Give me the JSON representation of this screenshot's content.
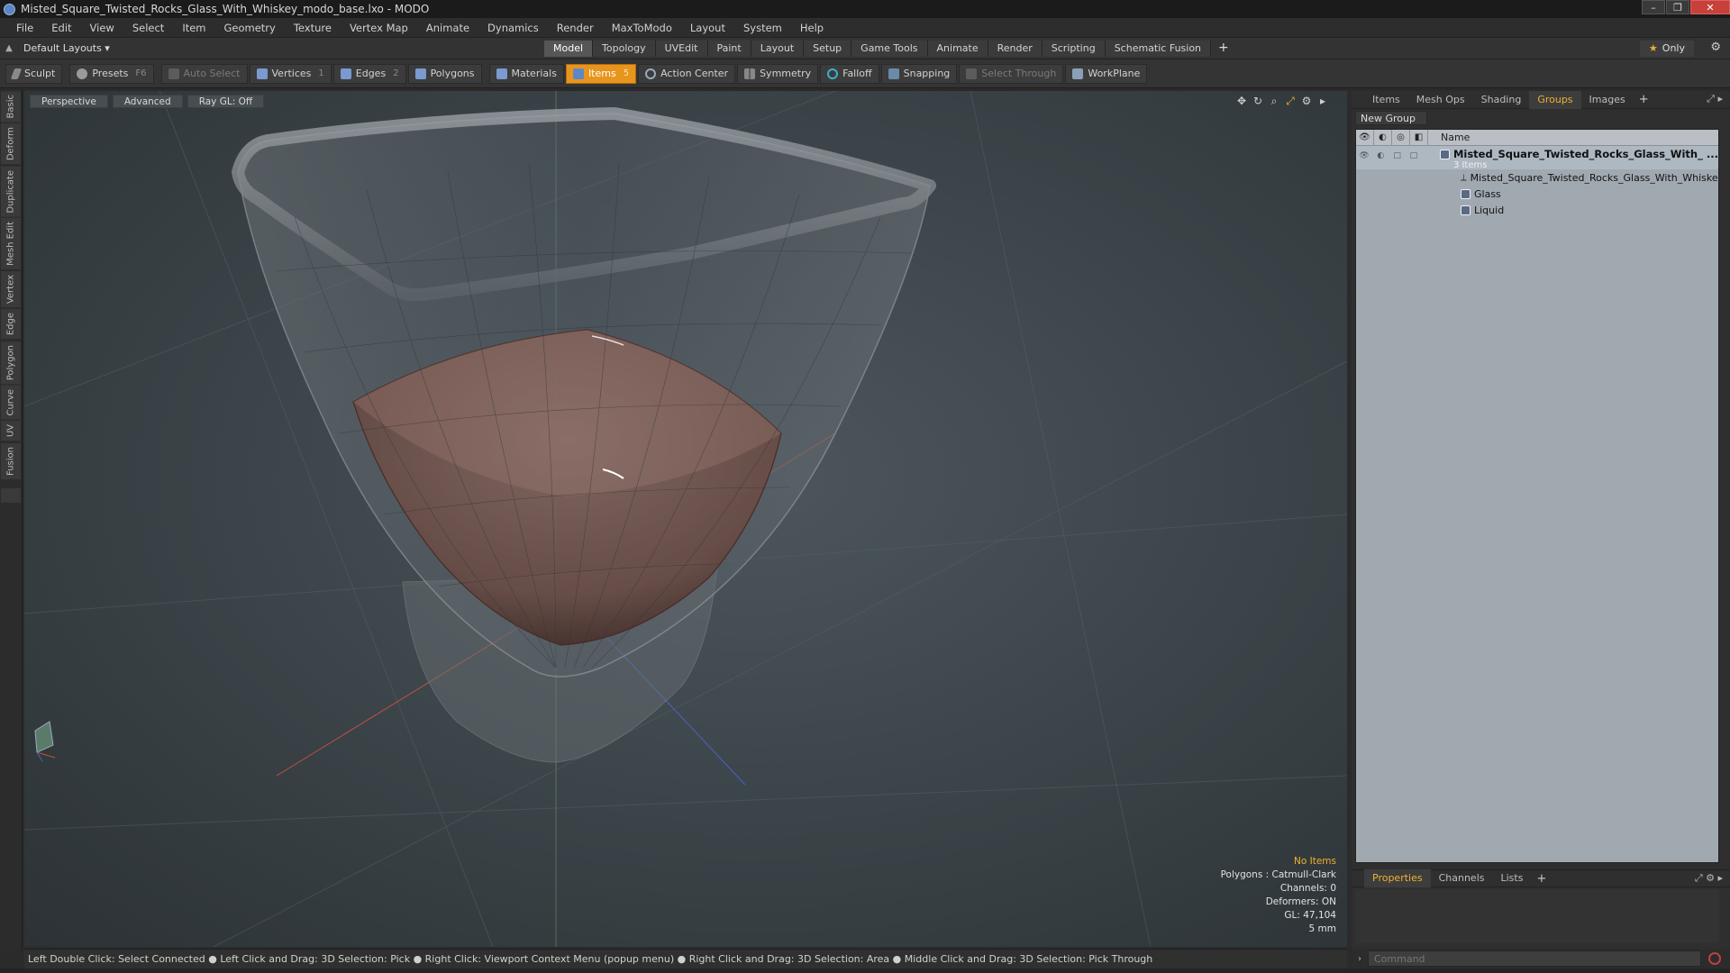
{
  "window": {
    "title": "Misted_Square_Twisted_Rocks_Glass_With_Whiskey_modo_base.lxo - MODO",
    "controls": [
      "–",
      "❐",
      "✕"
    ]
  },
  "menu": [
    "File",
    "Edit",
    "View",
    "Select",
    "Item",
    "Geometry",
    "Texture",
    "Vertex Map",
    "Animate",
    "Dynamics",
    "Render",
    "MaxToModo",
    "Layout",
    "System",
    "Help"
  ],
  "layout_bar": {
    "layout_select": "Default Layouts ▾",
    "tabs": [
      "Model",
      "Topology",
      "UVEdit",
      "Paint",
      "Layout",
      "Setup",
      "Game Tools",
      "Animate",
      "Render",
      "Scripting",
      "Schematic Fusion"
    ],
    "active_tab": "Model",
    "only_label": "Only"
  },
  "toolbar": {
    "sculpt": "Sculpt",
    "presets": "Presets",
    "presets_key": "F6",
    "auto_select": "Auto Select",
    "vertices": "Vertices",
    "vertices_count": "1",
    "edges": "Edges",
    "edges_count": "2",
    "polygons": "Polygons",
    "materials": "Materials",
    "items": "Items",
    "items_count": "5",
    "action_center": "Action Center",
    "symmetry": "Symmetry",
    "falloff": "Falloff",
    "snapping": "Snapping",
    "select_through": "Select Through",
    "workplane": "WorkPlane"
  },
  "left_tabs": [
    "Basic",
    "Deform",
    "Duplicate",
    "Mesh Edit",
    "Vertex",
    "Edge",
    "Polygon",
    "Curve",
    "UV",
    "Fusion"
  ],
  "viewport": {
    "view_mode": "Perspective",
    "shading": "Advanced",
    "raygl": "Ray GL: Off",
    "info": {
      "no_items": "No Items",
      "polygons": "Polygons : Catmull-Clark",
      "channels": "Channels: 0",
      "deformers": "Deformers: ON",
      "gl": "GL: 47,104",
      "scale": "5 mm"
    }
  },
  "status_bar": "Left Double Click: Select Connected ● Left Click and Drag: 3D Selection: Pick ● Right Click: Viewport Context Menu (popup menu) ● Right Click and Drag: 3D Selection: Area ● Middle Click and Drag: 3D Selection: Pick Through",
  "right_panel": {
    "tabs": [
      "Items",
      "Mesh Ops",
      "Shading",
      "Groups",
      "Images"
    ],
    "active_tab": "Groups",
    "new_group": "New Group",
    "column_name": "Name",
    "group": {
      "name": "Misted_Square_Twisted_Rocks_Glass_With_ ...",
      "count": "3 Items",
      "children": [
        "Misted_Square_Twisted_Rocks_Glass_With_Whiskey",
        "Glass",
        "Liquid"
      ]
    },
    "bottom_tabs": [
      "Properties",
      "Channels",
      "Lists"
    ],
    "bottom_active": "Properties",
    "command_placeholder": "Command"
  }
}
